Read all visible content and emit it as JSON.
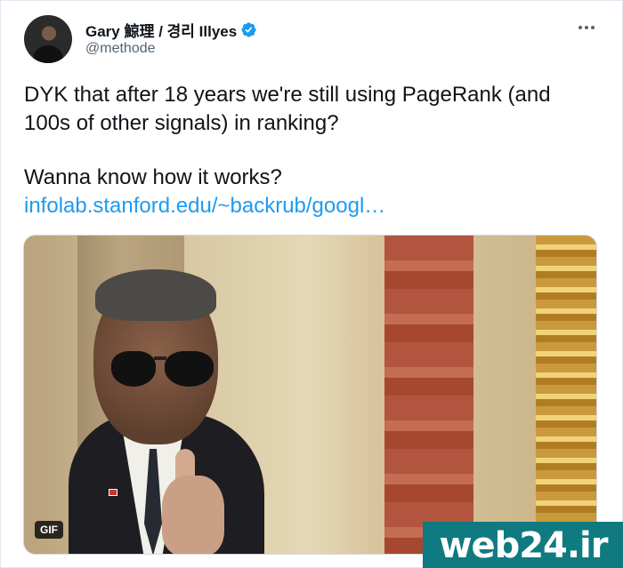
{
  "author": {
    "display_name": "Gary 鯨理 / 경리 Illyes",
    "handle": "@methode",
    "verified": true,
    "avatar_icon": "user-avatar"
  },
  "more_icon": "more-options-icon",
  "tweet": {
    "line1": "DYK that after 18 years we're still using PageRank (and 100s of other signals) in ranking?",
    "line2": "Wanna know how it works?",
    "link_text": "infolab.stanford.edu/~backrub/googl…"
  },
  "media": {
    "badge": "GIF"
  },
  "watermark": {
    "text": "web24.ir"
  },
  "colors": {
    "link": "#1d9bf0",
    "verified": "#1d9bf0",
    "watermark_bg": "#0f7b80"
  }
}
